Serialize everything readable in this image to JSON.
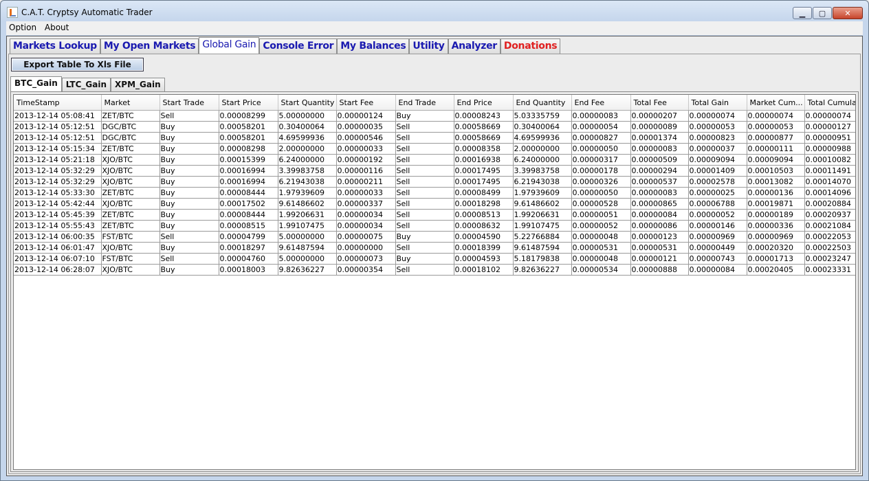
{
  "window": {
    "title": "C.A.T. Cryptsy Automatic Trader"
  },
  "menu": [
    "Option",
    "About"
  ],
  "tabs": [
    {
      "label": "Markets Lookup",
      "active": false,
      "color": "blue"
    },
    {
      "label": "My Open Markets",
      "active": false,
      "color": "blue"
    },
    {
      "label": "Global Gain",
      "active": true,
      "color": "blue"
    },
    {
      "label": "Console Error",
      "active": false,
      "color": "blue"
    },
    {
      "label": "My Balances",
      "active": false,
      "color": "blue"
    },
    {
      "label": "Utility",
      "active": false,
      "color": "blue"
    },
    {
      "label": "Analyzer",
      "active": false,
      "color": "blue"
    },
    {
      "label": "Donations",
      "active": false,
      "color": "red"
    }
  ],
  "export_button": "Export Table To Xls File",
  "subtabs": [
    {
      "label": "BTC_Gain",
      "active": true
    },
    {
      "label": "LTC_Gain",
      "active": false
    },
    {
      "label": "XPM_Gain",
      "active": false
    }
  ],
  "table": {
    "columns": [
      "TimeStamp",
      "Market",
      "Start Trade",
      "Start Price",
      "Start Quantity",
      "Start Fee",
      "End Trade",
      "End Price",
      "End Quantity",
      "End Fee",
      "Total Fee",
      "Total Gain",
      "Market Cum...",
      "Total Cumula..."
    ],
    "rows": [
      [
        "2013-12-14 05:08:41",
        "ZET/BTC",
        "Sell",
        "0.00008299",
        "5.00000000",
        "0.00000124",
        "Buy",
        "0.00008243",
        "5.03335759",
        "0.00000083",
        "0.00000207",
        "0.00000074",
        "0.00000074",
        "0.00000074"
      ],
      [
        "2013-12-14 05:12:51",
        "DGC/BTC",
        "Buy",
        "0.00058201",
        "0.30400064",
        "0.00000035",
        "Sell",
        "0.00058669",
        "0.30400064",
        "0.00000054",
        "0.00000089",
        "0.00000053",
        "0.00000053",
        "0.00000127"
      ],
      [
        "2013-12-14 05:12:51",
        "DGC/BTC",
        "Buy",
        "0.00058201",
        "4.69599936",
        "0.00000546",
        "Sell",
        "0.00058669",
        "4.69599936",
        "0.00000827",
        "0.00001374",
        "0.00000823",
        "0.00000877",
        "0.00000951"
      ],
      [
        "2013-12-14 05:15:34",
        "ZET/BTC",
        "Buy",
        "0.00008298",
        "2.00000000",
        "0.00000033",
        "Sell",
        "0.00008358",
        "2.00000000",
        "0.00000050",
        "0.00000083",
        "0.00000037",
        "0.00000111",
        "0.00000988"
      ],
      [
        "2013-12-14 05:21:18",
        "XJO/BTC",
        "Buy",
        "0.00015399",
        "6.24000000",
        "0.00000192",
        "Sell",
        "0.00016938",
        "6.24000000",
        "0.00000317",
        "0.00000509",
        "0.00009094",
        "0.00009094",
        "0.00010082"
      ],
      [
        "2013-12-14 05:32:29",
        "XJO/BTC",
        "Buy",
        "0.00016994",
        "3.39983758",
        "0.00000116",
        "Sell",
        "0.00017495",
        "3.39983758",
        "0.00000178",
        "0.00000294",
        "0.00001409",
        "0.00010503",
        "0.00011491"
      ],
      [
        "2013-12-14 05:32:29",
        "XJO/BTC",
        "Buy",
        "0.00016994",
        "6.21943038",
        "0.00000211",
        "Sell",
        "0.00017495",
        "6.21943038",
        "0.00000326",
        "0.00000537",
        "0.00002578",
        "0.00013082",
        "0.00014070"
      ],
      [
        "2013-12-14 05:33:30",
        "ZET/BTC",
        "Buy",
        "0.00008444",
        "1.97939609",
        "0.00000033",
        "Sell",
        "0.00008499",
        "1.97939609",
        "0.00000050",
        "0.00000083",
        "0.00000025",
        "0.00000136",
        "0.00014096"
      ],
      [
        "2013-12-14 05:42:44",
        "XJO/BTC",
        "Buy",
        "0.00017502",
        "9.61486602",
        "0.00000337",
        "Sell",
        "0.00018298",
        "9.61486602",
        "0.00000528",
        "0.00000865",
        "0.00006788",
        "0.00019871",
        "0.00020884"
      ],
      [
        "2013-12-14 05:45:39",
        "ZET/BTC",
        "Buy",
        "0.00008444",
        "1.99206631",
        "0.00000034",
        "Sell",
        "0.00008513",
        "1.99206631",
        "0.00000051",
        "0.00000084",
        "0.00000052",
        "0.00000189",
        "0.00020937"
      ],
      [
        "2013-12-14 05:55:43",
        "ZET/BTC",
        "Buy",
        "0.00008515",
        "1.99107475",
        "0.00000034",
        "Sell",
        "0.00008632",
        "1.99107475",
        "0.00000052",
        "0.00000086",
        "0.00000146",
        "0.00000336",
        "0.00021084"
      ],
      [
        "2013-12-14 06:00:35",
        "FST/BTC",
        "Sell",
        "0.00004799",
        "5.00000000",
        "0.00000075",
        "Buy",
        "0.00004590",
        "5.22766884",
        "0.00000048",
        "0.00000123",
        "0.00000969",
        "0.00000969",
        "0.00022053"
      ],
      [
        "2013-12-14 06:01:47",
        "XJO/BTC",
        "Buy",
        "0.00018297",
        "9.61487594",
        "0.00000000",
        "Sell",
        "0.00018399",
        "9.61487594",
        "0.00000531",
        "0.00000531",
        "0.00000449",
        "0.00020320",
        "0.00022503"
      ],
      [
        "2013-12-14 06:07:10",
        "FST/BTC",
        "Sell",
        "0.00004760",
        "5.00000000",
        "0.00000073",
        "Buy",
        "0.00004593",
        "5.18179838",
        "0.00000048",
        "0.00000121",
        "0.00000743",
        "0.00001713",
        "0.00023247"
      ],
      [
        "2013-12-14 06:28:07",
        "XJO/BTC",
        "Buy",
        "0.00018003",
        "9.82636227",
        "0.00000354",
        "Sell",
        "0.00018102",
        "9.82636227",
        "0.00000534",
        "0.00000888",
        "0.00000084",
        "0.00020405",
        "0.00023331"
      ]
    ]
  }
}
